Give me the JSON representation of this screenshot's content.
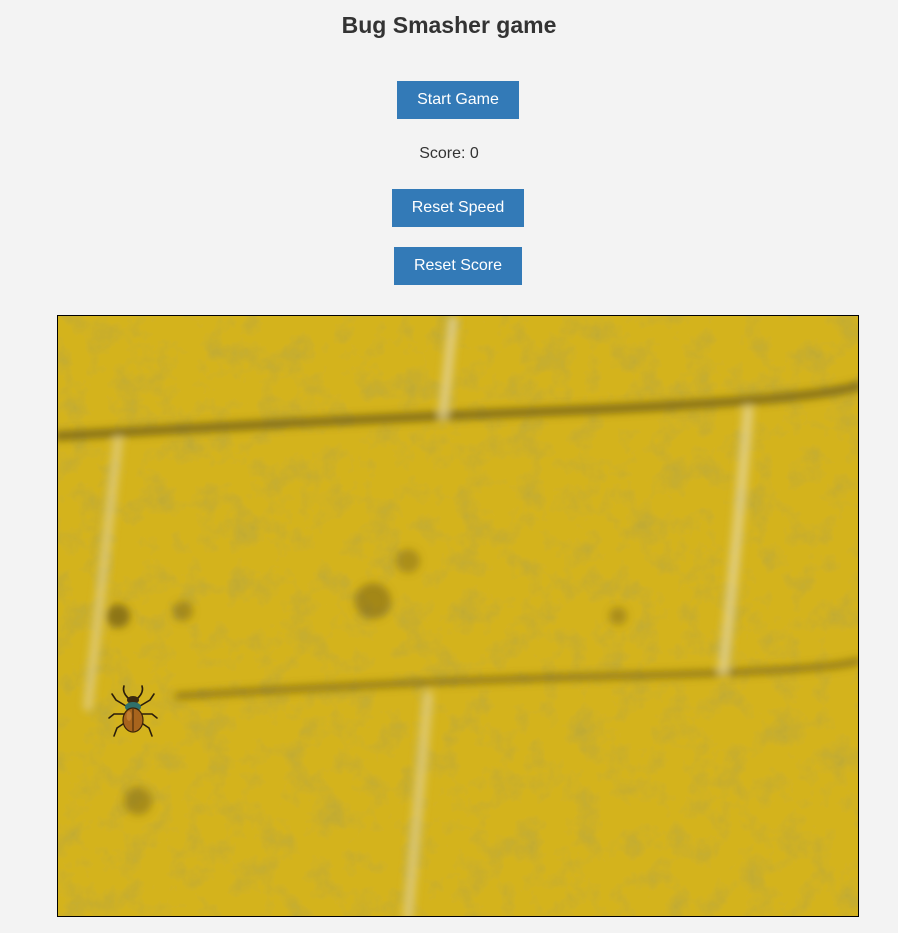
{
  "title": "Bug Smasher game",
  "buttons": {
    "start": "Start Game",
    "reset_speed": "Reset Speed",
    "reset_score": "Reset Score"
  },
  "score": {
    "label": "Score:",
    "value": 0,
    "text": "Score: 0"
  },
  "colors": {
    "button": "#337ab7",
    "page_background": "#f3f3f3",
    "board_background": "#d2b11c"
  },
  "icons": {
    "bug": "stag-beetle-icon"
  }
}
